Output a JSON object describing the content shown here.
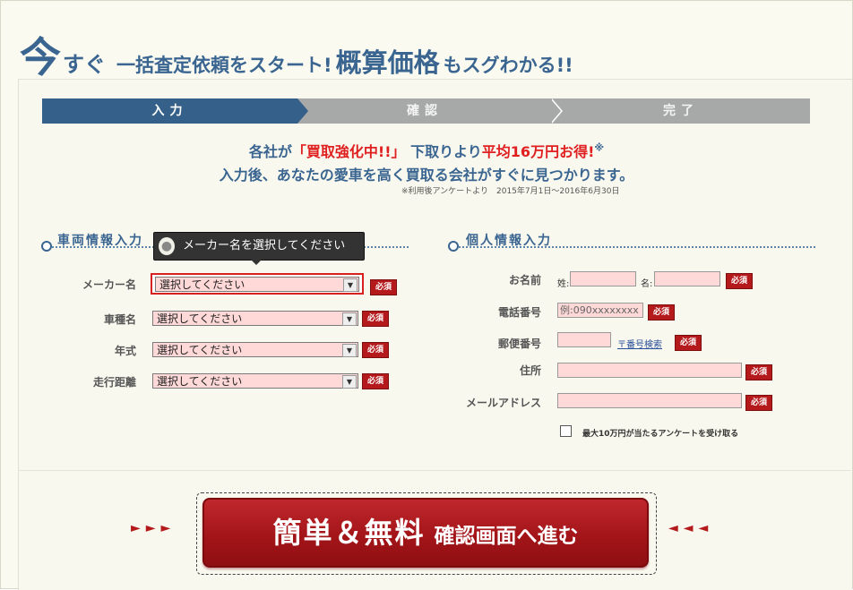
{
  "header": {
    "ima": "今",
    "sugu": "すぐ",
    "mid": "一括査定依頼をスタート!",
    "big": "概算価格",
    "tail": "もスグわかる!!"
  },
  "steps": [
    "入力",
    "確認",
    "完了"
  ],
  "promo": {
    "line1_a": "各社が",
    "line1_red1": "「買取強化中!!」",
    "line1_b": "下取りより",
    "line1_red2": "平均16万円お得!",
    "line1_mark": "※",
    "line2": "入力後、あなたの愛車を高く買取る会社がすぐに見つかります。",
    "note": "※利用後アンケートより　2015年7月1日〜2016年6月30日"
  },
  "vehicle": {
    "title": "車両情報入力",
    "tooltip": "メーカー名を選択してください",
    "fields": [
      {
        "label": "メーカー名",
        "value": "選択してください"
      },
      {
        "label": "車種名",
        "value": "選択してください"
      },
      {
        "label": "年式",
        "value": "選択してください"
      },
      {
        "label": "走行距離",
        "value": "選択してください"
      }
    ]
  },
  "personal": {
    "title": "個人情報入力",
    "name_label": "お名前",
    "sei": "姓:",
    "mei": "名:",
    "phone_label": "電話番号",
    "phone_placeholder": "例:090xxxxxxxx",
    "zip_label": "郵便番号",
    "zip_link": "〒番号検索",
    "address_label": "住所",
    "email_label": "メールアドレス",
    "survey_label": "最大10万円が当たるアンケートを受け取る"
  },
  "required": "必須",
  "cta": {
    "main": "簡単＆無料",
    "sub": "確認画面へ進む",
    "left_arrows": "►►►",
    "right_arrows": "◄◄◄"
  },
  "colors": {
    "brand": "#3a6591",
    "required": "#b4191c",
    "field": "#ffd8d8"
  }
}
